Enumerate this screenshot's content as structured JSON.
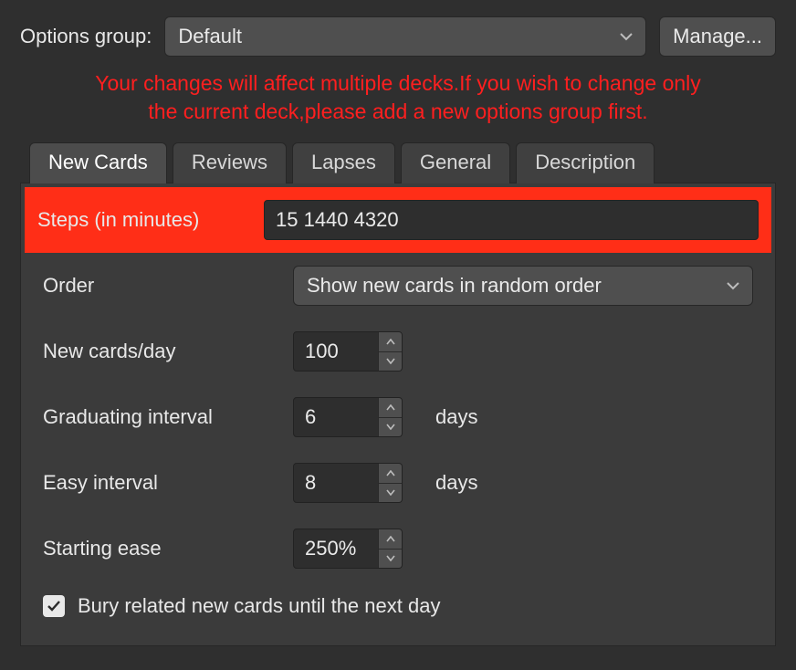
{
  "header": {
    "options_group_label": "Options group:",
    "options_group_value": "Default",
    "manage_label": "Manage..."
  },
  "warning_line1": "Your changes will affect multiple decks.If you wish to change only",
  "warning_line2": "the current deck,please add a new options group first.",
  "tabs": {
    "new_cards": "New Cards",
    "reviews": "Reviews",
    "lapses": "Lapses",
    "general": "General",
    "description": "Description"
  },
  "fields": {
    "steps_label": "Steps (in minutes)",
    "steps_value": "15 1440 4320",
    "order_label": "Order",
    "order_value": "Show new cards in random order",
    "new_per_day_label": "New cards/day",
    "new_per_day_value": "100",
    "grad_interval_label": "Graduating interval",
    "grad_interval_value": "6",
    "easy_interval_label": "Easy interval",
    "easy_interval_value": "8",
    "starting_ease_label": "Starting ease",
    "starting_ease_value": "250%",
    "days_suffix": "days",
    "bury_label": "Bury related new cards until the next day",
    "bury_checked": true
  }
}
